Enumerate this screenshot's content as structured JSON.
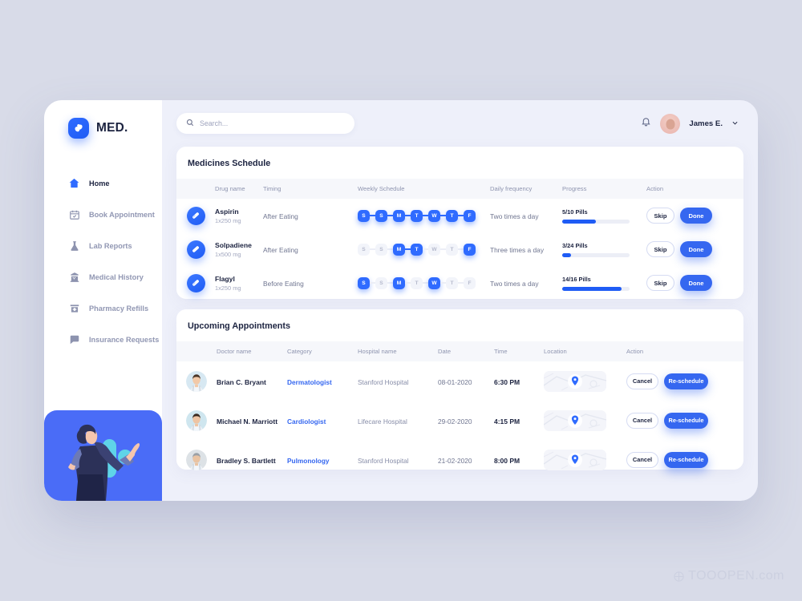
{
  "brand": {
    "name": "MED.",
    "logo_icon": "pill-capsule-icon",
    "accent": "#2f6bff"
  },
  "sidebar": {
    "items": [
      {
        "label": "Home",
        "icon": "home-icon",
        "active": true
      },
      {
        "label": "Book Appointment",
        "icon": "calendar-check-icon",
        "active": false
      },
      {
        "label": "Lab Reports",
        "icon": "flask-icon",
        "active": false
      },
      {
        "label": "Medical History",
        "icon": "hospital-building-icon",
        "active": false
      },
      {
        "label": "Pharmacy Refills",
        "icon": "pharmacy-icon",
        "active": false
      },
      {
        "label": "Insurance Requests",
        "icon": "message-bubble-icon",
        "active": false
      }
    ]
  },
  "topbar": {
    "search_placeholder": "Search...",
    "search_value": "",
    "search_icon": "search-icon",
    "bell_icon": "bell-icon",
    "user_name": "James E.",
    "chevron_icon": "chevron-down-icon"
  },
  "medicines": {
    "title": "Medicines Schedule",
    "columns": [
      "Drug name",
      "Timing",
      "Weekly Schedule",
      "Daily frequency",
      "Progress",
      "Action"
    ],
    "day_letters": [
      "S",
      "S",
      "M",
      "T",
      "W",
      "T",
      "F"
    ],
    "skip_label": "Skip",
    "done_label": "Done",
    "rows": [
      {
        "icon": "pill-icon",
        "name": "Aspirin",
        "dose": "1x250 mg",
        "timing": "After Eating",
        "days": [
          true,
          true,
          true,
          true,
          true,
          true,
          true
        ],
        "frequency": "Two times a day",
        "progress_label": "5/10 Pills",
        "progress_pct": 50
      },
      {
        "icon": "capsule-icon",
        "name": "Solpadiene",
        "dose": "1x500 mg",
        "timing": "After Eating",
        "days": [
          false,
          false,
          true,
          true,
          false,
          false,
          true
        ],
        "frequency": "Three times a day",
        "progress_label": "3/24 Pills",
        "progress_pct": 13
      },
      {
        "icon": "pill-icon",
        "name": "Flagyl",
        "dose": "1x250 mg",
        "timing": "Before Eating",
        "days": [
          true,
          false,
          true,
          false,
          true,
          false,
          false
        ],
        "frequency": "Two times a day",
        "progress_label": "14/16 Pills",
        "progress_pct": 88
      }
    ]
  },
  "appointments": {
    "title": "Upcoming Appointments",
    "columns": [
      "Doctor name",
      "Category",
      "Hospital name",
      "Date",
      "Time",
      "Location",
      "Action"
    ],
    "cancel_label": "Cancel",
    "reschedule_label": "Re-schedule",
    "location_icon": "map-pin-icon",
    "rows": [
      {
        "avatar": "doctor-avatar",
        "name": "Brian C. Bryant",
        "category": "Dermatologist",
        "hospital": "Stanford Hospital",
        "date": "08-01-2020",
        "time": "6:30 PM"
      },
      {
        "avatar": "doctor-avatar",
        "name": "Michael N. Marriott",
        "category": "Cardiologist",
        "hospital": "Lifecare Hospital",
        "date": "29-02-2020",
        "time": "4:15 PM"
      },
      {
        "avatar": "doctor-avatar",
        "name": "Bradley S. Bartlett",
        "category": "Pulmonology",
        "hospital": "Stanford Hospital",
        "date": "21-02-2020",
        "time": "8:00 PM"
      }
    ]
  },
  "watermark": {
    "text": "TOOOPEN.com"
  }
}
